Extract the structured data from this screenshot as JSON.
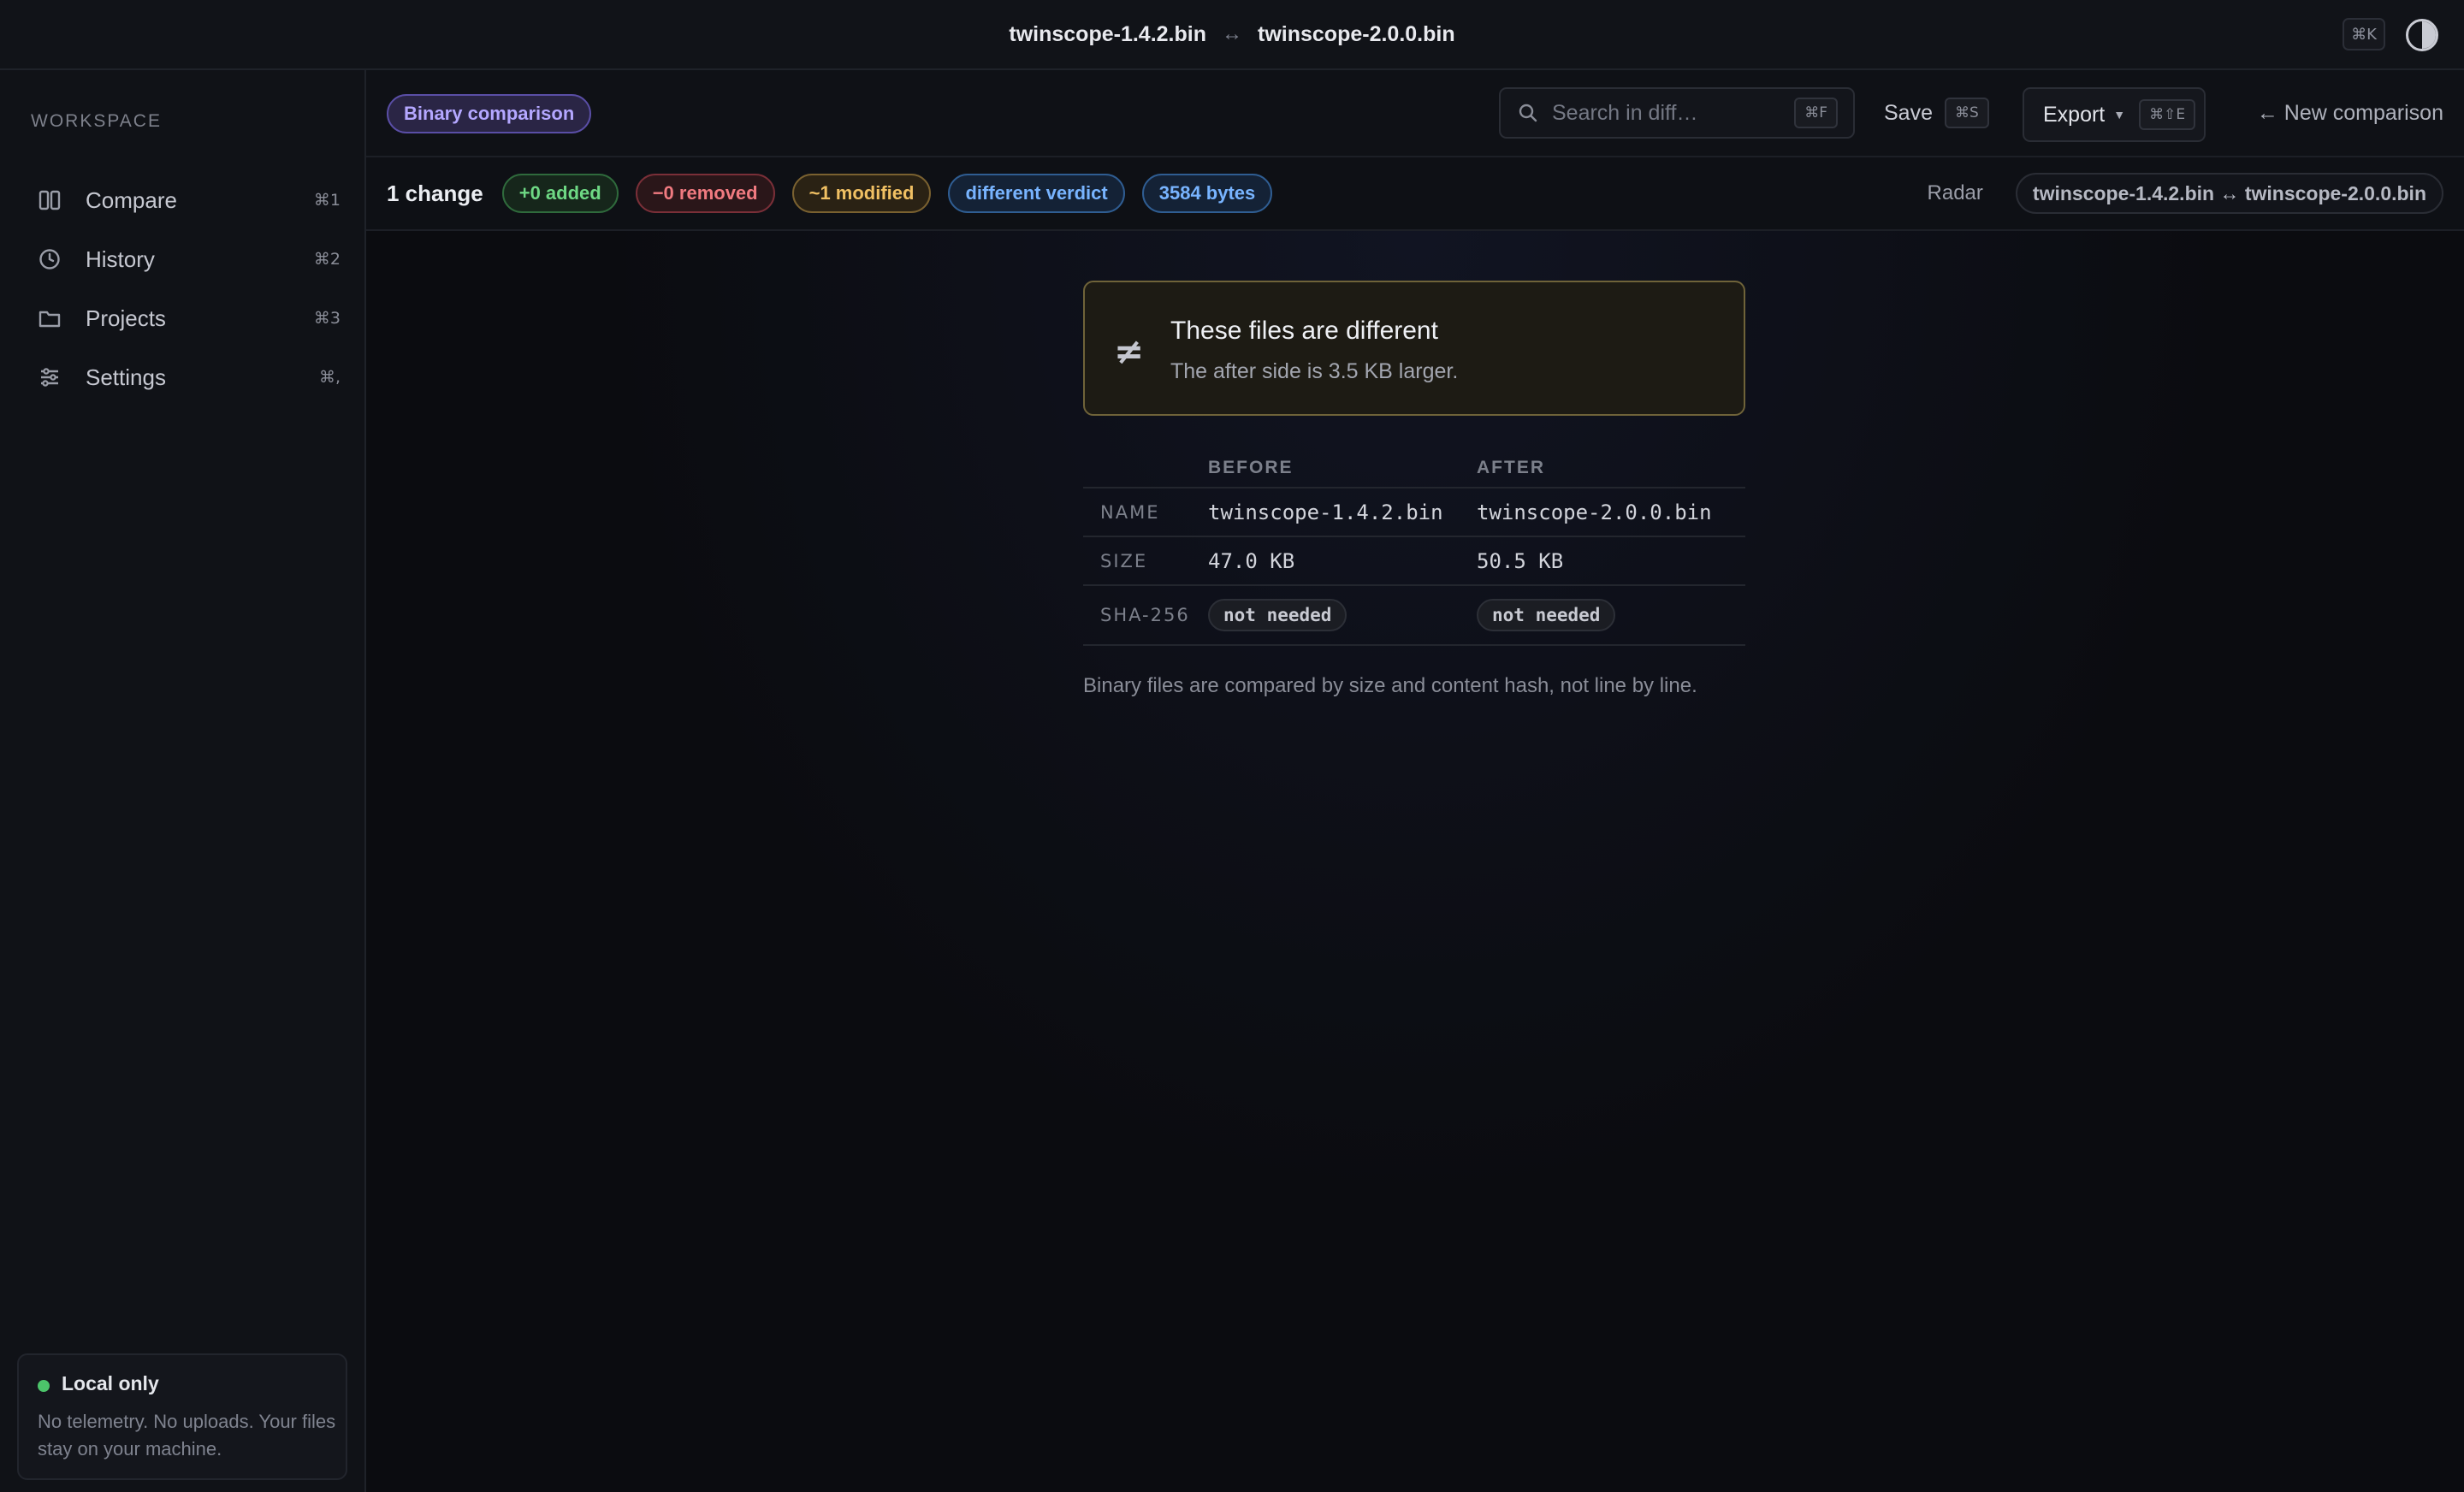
{
  "titlebar": {
    "before_file": "twinscope-1.4.2.bin",
    "arrow": "↔",
    "after_file": "twinscope-2.0.0.bin",
    "command_kbd": "⌘K",
    "icons": {
      "theme_toggle": "half-circle-icon"
    }
  },
  "sidebar": {
    "section_label": "Workspace",
    "items": [
      {
        "label": "Compare",
        "kbd": "⌘1",
        "icon": "columns-icon"
      },
      {
        "label": "History",
        "kbd": "⌘2",
        "icon": "clock-icon"
      },
      {
        "label": "Projects",
        "kbd": "⌘3",
        "icon": "folder-icon"
      },
      {
        "label": "Settings",
        "kbd": "⌘,",
        "icon": "sliders-icon"
      }
    ],
    "local_card": {
      "title": "Local only",
      "text": "No telemetry. No uploads. Your files stay on your machine.",
      "status_color": "#4cc46a"
    }
  },
  "toolbar": {
    "mode": "Binary comparison",
    "search_placeholder": "Search in diff…",
    "search_kbd": "⌘F",
    "save_label": "Save",
    "save_kbd": "⌘S",
    "export_label": "Export",
    "export_kbd": "⌘⇧E",
    "new_comparison_label": "← New comparison"
  },
  "stats": {
    "change_count": "1 change",
    "added": "+0 added",
    "removed": "−0 removed",
    "modified": "~1 modified",
    "verdict": "different verdict",
    "bytes": "3584 bytes",
    "view_label": "Radar",
    "pair": "twinscope-1.4.2.bin ↔ twinscope-2.0.0.bin"
  },
  "verdict": {
    "icon": "not-equal-icon",
    "title": "These files are different",
    "subtitle": "The after side is 3.5 KB larger."
  },
  "table": {
    "headers": {
      "before": "BEFORE",
      "after": "AFTER"
    },
    "rows": {
      "name": {
        "label": "NAME",
        "before": "twinscope-1.4.2.bin",
        "after": "twinscope-2.0.0.bin"
      },
      "size": {
        "label": "SIZE",
        "before": "47.0 KB",
        "after": "50.5 KB"
      },
      "sha": {
        "label": "SHA-256",
        "before": "not needed",
        "after": "not needed"
      }
    }
  },
  "footnote": "Binary files are compared by size and content hash, not line by line.",
  "colors": {
    "accent_purple": "#b4a7ff",
    "added_green": "#6ed884",
    "removed_red": "#f07a80",
    "modified_amber": "#f0c063",
    "info_blue": "#78b4ff"
  }
}
